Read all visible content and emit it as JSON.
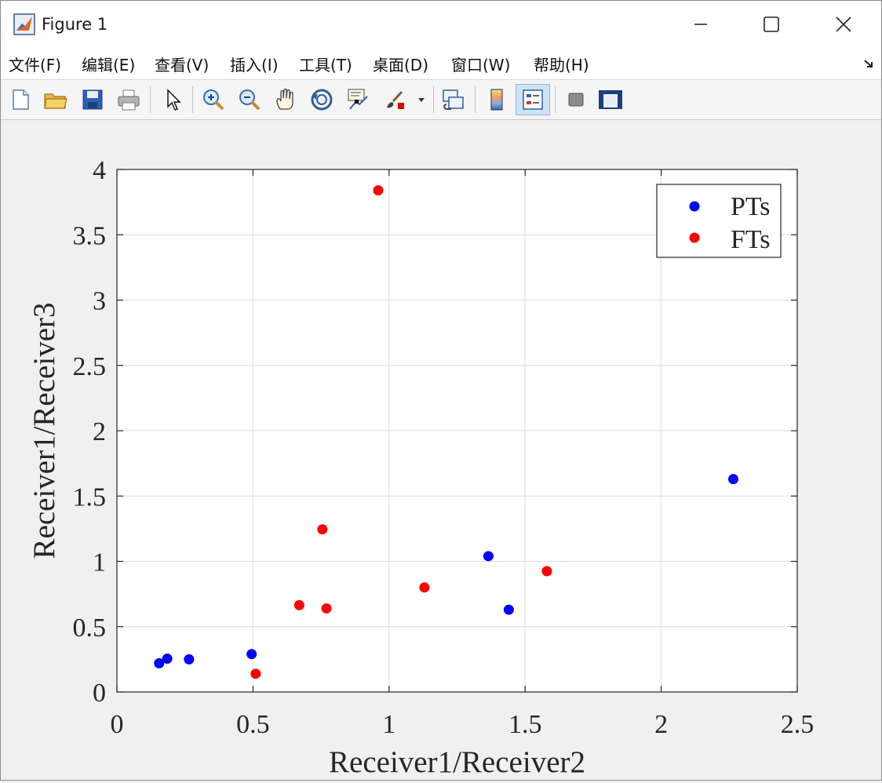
{
  "window": {
    "title": "Figure 1",
    "icon": "matlab-icon",
    "controls": [
      "minimize-icon",
      "maximize-icon",
      "close-icon"
    ]
  },
  "menu": {
    "items": [
      "文件(F)",
      "编辑(E)",
      "查看(V)",
      "插入(I)",
      "工具(T)",
      "桌面(D)",
      "窗口(W)",
      "帮助(H)"
    ],
    "dock_icon": "dock-arrow-icon"
  },
  "toolbar": {
    "icons": [
      "new-figure-icon",
      "open-file-icon",
      "save-icon",
      "print-icon",
      "pointer-icon",
      "zoom-in-icon",
      "zoom-out-icon",
      "pan-hand-icon",
      "rotate-3d-icon",
      "data-cursor-icon",
      "brush-icon",
      "brush-dropdown-icon",
      "link-plot-icon",
      "colorbar-icon",
      "legend-icon",
      "hide-plot-tools-icon",
      "show-plot-tools-icon"
    ],
    "active": "legend-icon"
  },
  "chart_data": {
    "type": "scatter",
    "title": "",
    "xlabel": "Receiver1/Receiver2",
    "ylabel": "Receiver1/Receiver3",
    "xlim": [
      0,
      2.5
    ],
    "ylim": [
      0,
      4
    ],
    "xticks": [
      "0",
      "0.5",
      "1",
      "1.5",
      "2",
      "2.5"
    ],
    "yticks": [
      "0",
      "0.5",
      "1",
      "1.5",
      "2",
      "2.5",
      "3",
      "3.5",
      "4"
    ],
    "grid": true,
    "legend_position": "top-right",
    "series": [
      {
        "name": "PTs",
        "color": "#0000ff",
        "points": [
          [
            0.155,
            0.22
          ],
          [
            0.185,
            0.255
          ],
          [
            0.265,
            0.25
          ],
          [
            0.495,
            0.29
          ],
          [
            1.365,
            1.04
          ],
          [
            1.44,
            0.63
          ],
          [
            2.265,
            1.63
          ]
        ]
      },
      {
        "name": "FTs",
        "color": "#ff0000",
        "points": [
          [
            0.51,
            0.14
          ],
          [
            0.67,
            0.665
          ],
          [
            0.755,
            1.245
          ],
          [
            0.77,
            0.64
          ],
          [
            0.96,
            3.84
          ],
          [
            1.13,
            0.8
          ],
          [
            1.58,
            0.925
          ]
        ]
      }
    ]
  }
}
